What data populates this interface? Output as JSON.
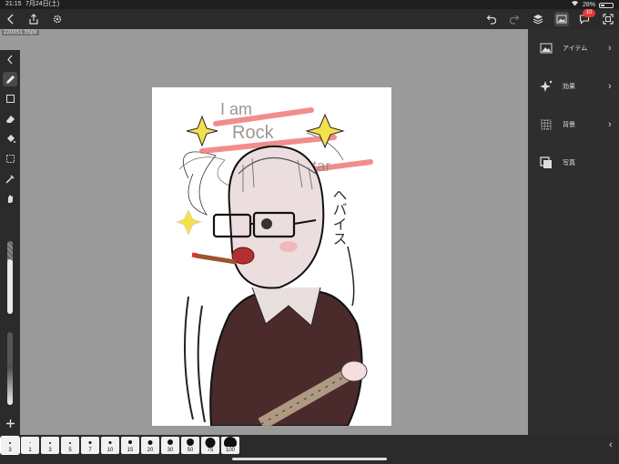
{
  "status_bar": {
    "time": "21:15",
    "date": "7月24日(土)",
    "battery": "28%"
  },
  "toolbar": {
    "back_icon": "chevron-left-icon",
    "share_icon": "share-icon",
    "settings_icon": "gear-icon",
    "undo_icon": "undo-icon",
    "redo_icon": "redo-icon",
    "layers_icon": "layers-icon",
    "image_icon": "image-icon",
    "notifications_badge": "10",
    "fullscreen_icon": "fullscreen-icon"
  },
  "canvas": {
    "size_label": "2203S1 3S(tir"
  },
  "right_panel": {
    "items": [
      {
        "label": "アイテム",
        "icon": "image-icon",
        "has_chevron": true
      },
      {
        "label": "効果",
        "icon": "sparkle-icon",
        "has_chevron": true
      },
      {
        "label": "背景",
        "icon": "grid-icon",
        "has_chevron": true
      },
      {
        "label": "写真",
        "icon": "photo-stack-icon",
        "has_chevron": false
      }
    ]
  },
  "brush_sizes": [
    "3",
    "1",
    "3",
    "5",
    "7",
    "10",
    "15",
    "20",
    "30",
    "50",
    "75",
    "100"
  ],
  "selected_brush_index": 0,
  "sliders": {
    "size_fraction": 0.75,
    "opacity_fraction": 0.55
  },
  "accent_color": "#e53935",
  "artwork": {
    "text_lines": [
      "I am",
      "Rock",
      "Star",
      "ヘバイス"
    ]
  }
}
